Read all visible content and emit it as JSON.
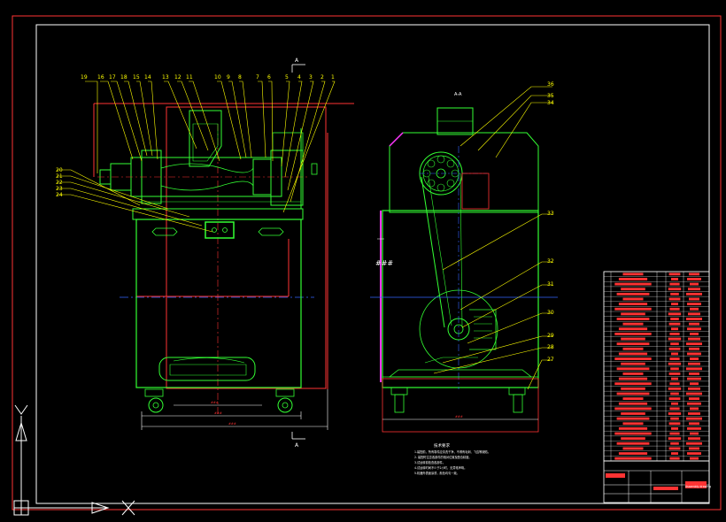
{
  "drawing": {
    "section_marker": "A",
    "callouts_front_top": [
      "19",
      "16",
      "17",
      "18",
      "15",
      "14",
      "13",
      "12",
      "11",
      "10",
      "9",
      "8",
      "7",
      "6",
      "5",
      "4",
      "3",
      "2",
      "1"
    ],
    "callouts_front_left": [
      "20",
      "21",
      "22",
      "23",
      "24"
    ],
    "callouts_side": [
      "36",
      "35",
      "34",
      "33",
      "32",
      "31",
      "30",
      "29",
      "28",
      "27"
    ],
    "side_top_label": "A-A",
    "dimension_values": [
      "###",
      "###",
      "###",
      "###",
      "###"
    ],
    "notes": {
      "title": "技术要求",
      "lines": [
        "1.装配前，所有零件应清洗干净，不得有毛刺、飞边等缺陷。",
        "2. 装配时注意各部件的相对位置及配合精度。",
        "3.试运转前检查各部件。",
        "4.试运转时间不少于2小时，无异常声响。",
        "5.机器外表面涂漆，颜色均匀一致。"
      ]
    },
    "bom": {
      "rows": 38,
      "title_block_name": "Assembly drawing"
    }
  },
  "colors": {
    "background": "#000000",
    "border": "#ff3333",
    "frame": "#ffffff",
    "part": "#33ff33",
    "hidden": "#ff3333",
    "centerline": "#3366ff",
    "leader": "#ffff00",
    "accent": "#ff33ff"
  }
}
